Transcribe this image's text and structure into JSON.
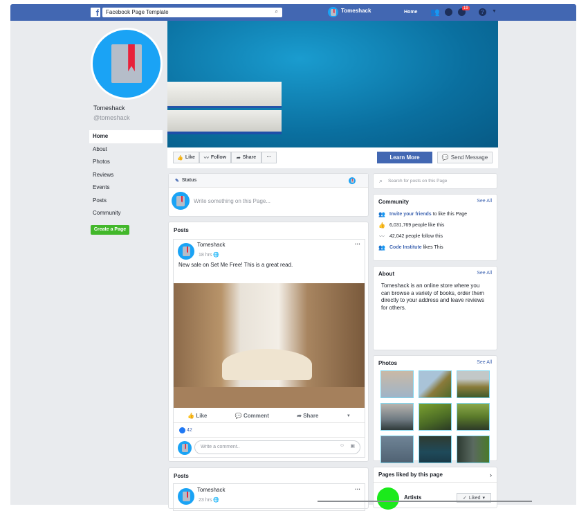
{
  "topbar": {
    "search_value": "Facebook Page Template",
    "brand": "Tomeshack",
    "home": "Home",
    "notifications": "19"
  },
  "profile": {
    "name": "Tomeshack",
    "handle": "@tomeshack"
  },
  "nav": [
    {
      "label": "Home"
    },
    {
      "label": "About"
    },
    {
      "label": "Photos"
    },
    {
      "label": "Reviews"
    },
    {
      "label": "Events"
    },
    {
      "label": "Posts"
    },
    {
      "label": "Community"
    }
  ],
  "create_page": "Create a Page",
  "actions": {
    "like": "Like",
    "follow": "Follow",
    "share": "Share",
    "more": "···",
    "learn_more": "Learn More",
    "send_message": "Send Message"
  },
  "status": {
    "label": "Status",
    "placeholder": "Write something on this Page..."
  },
  "posts": [
    {
      "section": "Posts",
      "author": "Tomeshack",
      "time": "18 hrs",
      "text": "New sale on Set Me Free! This is a great read.",
      "like": "Like",
      "comment": "Comment",
      "share": "Share",
      "likes": "42",
      "comment_placeholder": "Write a comment.."
    },
    {
      "section": "Posts",
      "author": "Tomeshack",
      "time": "23 hrs"
    }
  ],
  "sidebar": {
    "search_placeholder": "Search for posts on this Page",
    "community": {
      "title": "Community",
      "see_all": "See All",
      "invite_link": "Invite your friends",
      "invite_rest": " to like this Page",
      "likes": "6,031,769 people like this",
      "follows": "42,042 people follow this",
      "friend_link": "Code Institute",
      "friend_rest": " likes This"
    },
    "about": {
      "title": "About",
      "see_all": "See All",
      "text": "Tomeshack is an online store where you can browse a variety of books, order them directly to your address and leave reviews for others."
    },
    "photos": {
      "title": "Photos",
      "see_all": "See All"
    },
    "pages_liked": {
      "title": "Pages liked by this page",
      "item": "Artists",
      "liked": "Liked"
    }
  }
}
